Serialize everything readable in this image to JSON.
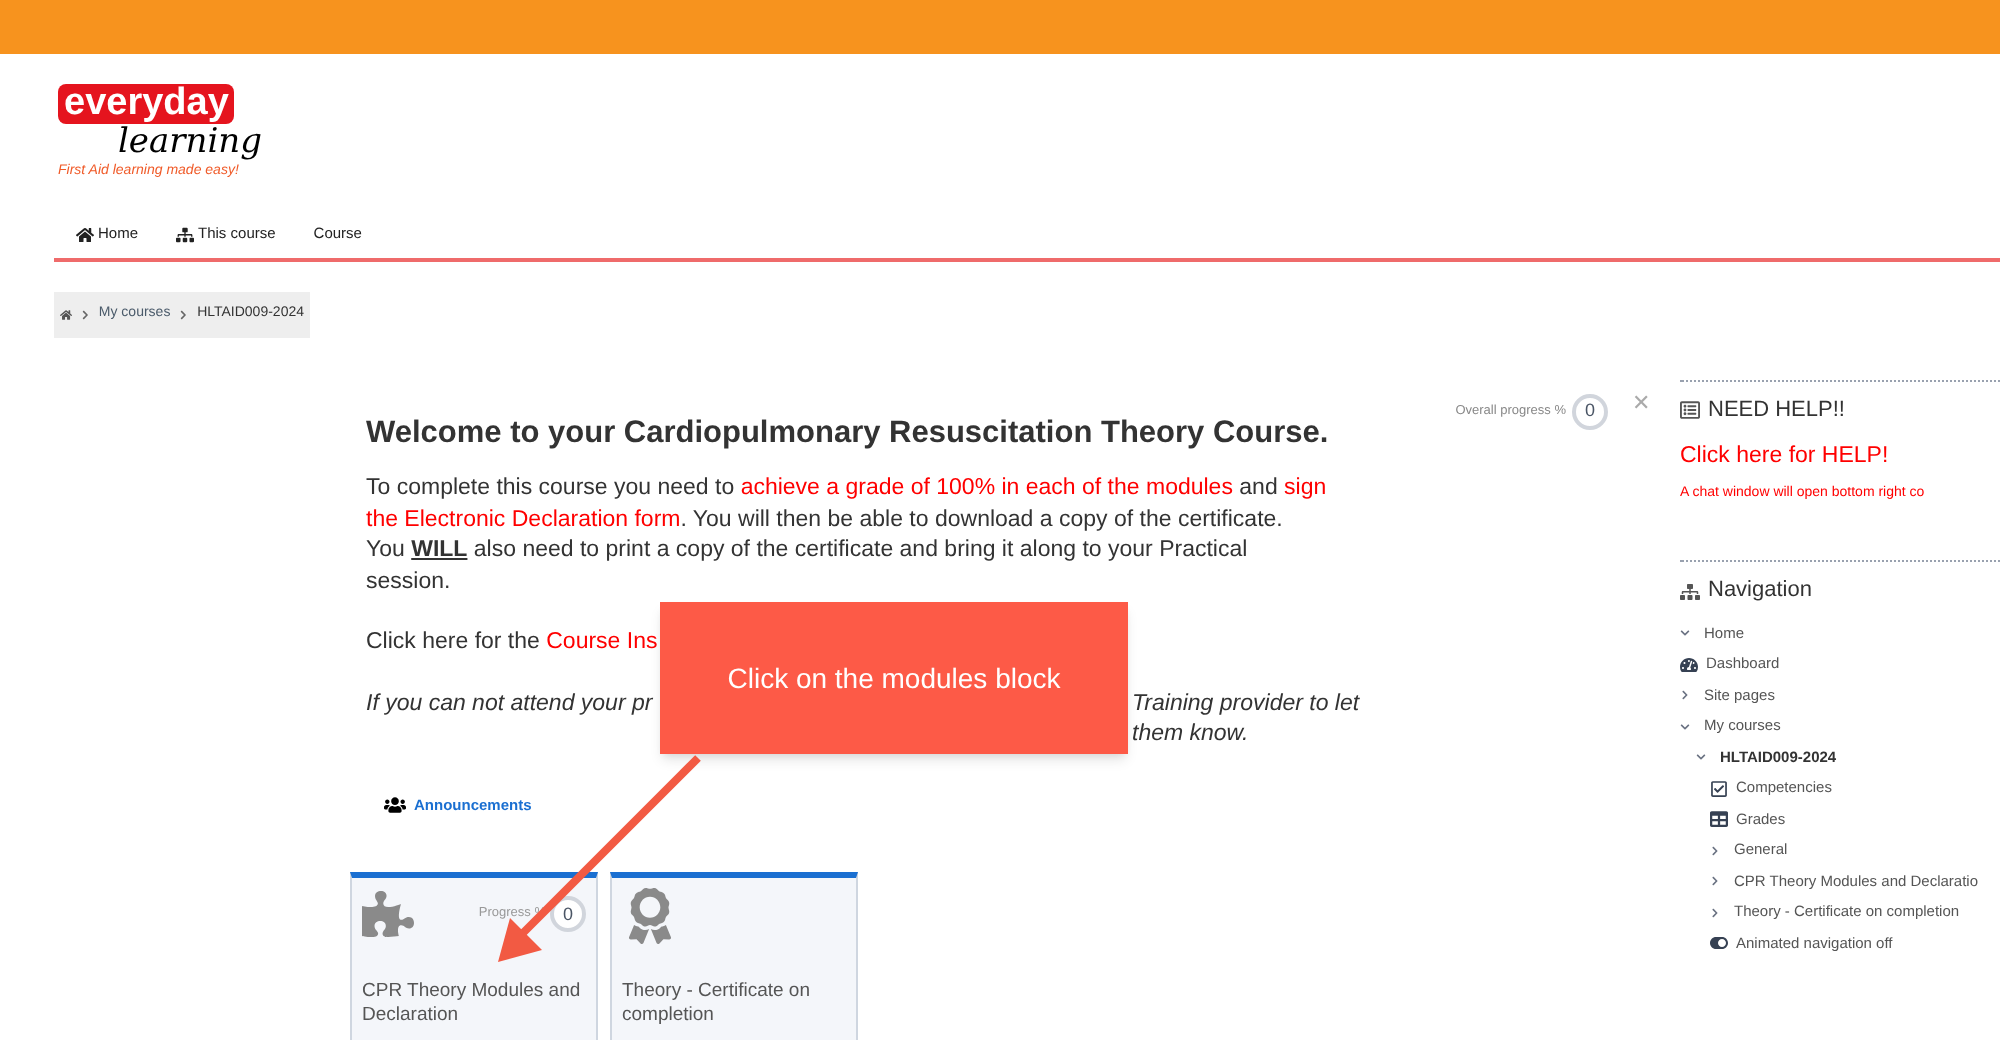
{
  "logo": {
    "brand": "everyday",
    "word": "learning",
    "tagline": "First Aid learning made easy!"
  },
  "nav": [
    "Home",
    "This course",
    "Course"
  ],
  "breadcrumb": [
    "My courses",
    "HLTAID009-2024"
  ],
  "overall_progress": {
    "label": "Overall progress %",
    "value": "0"
  },
  "course": {
    "title": "Welcome to your Cardiopulmonary Resuscitation Theory Course.",
    "intro": [
      {
        "text": "To complete this course you need to ",
        "kind": "plain"
      },
      {
        "text": "achieve a grade of 100% in each of the modules",
        "kind": "highlight"
      },
      {
        "text": " and ",
        "kind": "plain"
      },
      {
        "text": "sign the Electronic Declaration form",
        "kind": "highlight"
      },
      {
        "text": ". You will then be able to download a copy of the certificate.",
        "kind": "plain"
      },
      {
        "text": "You ",
        "kind": "break"
      },
      {
        "text": "WILL",
        "kind": "strong"
      },
      {
        "text": " also need to print a copy of the certificate and bring it along to your Practical session.",
        "kind": "plain"
      }
    ],
    "instructions_start": "Click here for the ",
    "instructions_link": "Course Ins",
    "attend_start": "If you can not attend your pr",
    "attend_end": "Training provider to let them know.",
    "announcements": "Announcements"
  },
  "callout": "Click on the modules block",
  "tiles": [
    {
      "title": "CPR Theory Modules and Declaration",
      "kind": "puzzle",
      "progress_label": "Progress %",
      "progress": "0"
    },
    {
      "title": "Theory - Certificate on completion",
      "kind": "award"
    }
  ],
  "close": "✕",
  "help": {
    "title": "NEED HELP!!",
    "link": "Click here for HELP!",
    "note": "A chat window will open bottom right co"
  },
  "navigation": {
    "title": "Navigation",
    "items": [
      {
        "label": "Home",
        "kind": "branch",
        "expanded": true
      },
      {
        "label": "Dashboard",
        "kind": "gauge"
      },
      {
        "label": "Site pages",
        "kind": "branch",
        "expanded": false
      },
      {
        "label": "My courses",
        "kind": "branch",
        "expanded": true,
        "children": [
          {
            "label": "HLTAID009-2024",
            "kind": "branch",
            "expanded": true,
            "children": [
              {
                "label": "Competencies",
                "kind": "checklist"
              },
              {
                "label": "Grades",
                "kind": "table"
              },
              {
                "label": "General",
                "kind": "branch",
                "expanded": false
              },
              {
                "label": "CPR Theory Modules and Declaratio",
                "kind": "branch",
                "expanded": false
              },
              {
                "label": "Theory - Certificate on completion",
                "kind": "branch",
                "expanded": false
              },
              {
                "label": "Animated navigation off",
                "kind": "toggle"
              }
            ]
          }
        ]
      }
    ]
  }
}
